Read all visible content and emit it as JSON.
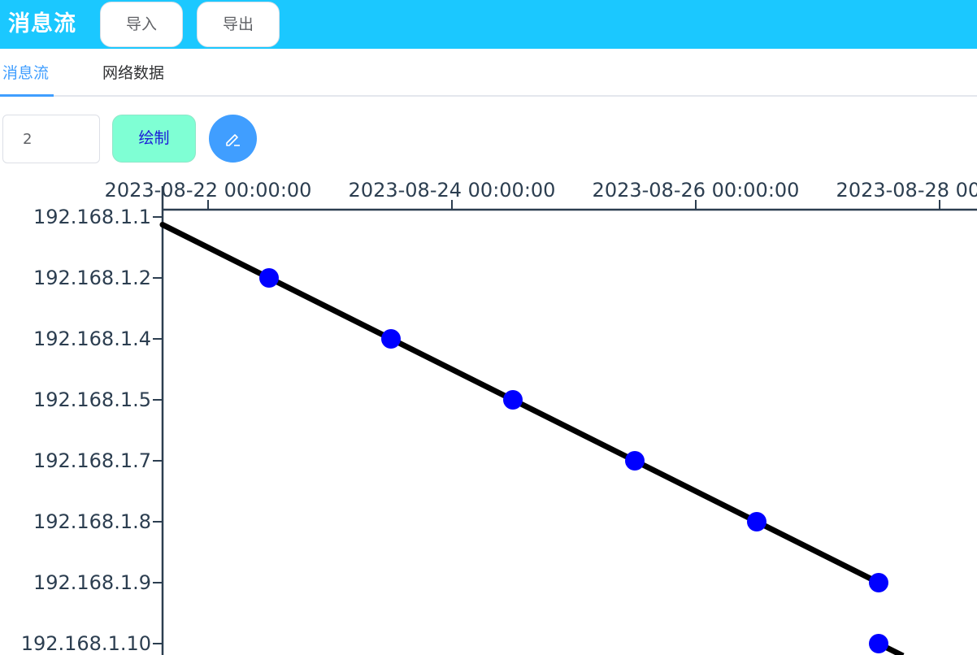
{
  "header": {
    "title": "消息流",
    "import_label": "导入",
    "export_label": "导出"
  },
  "tabs": [
    {
      "label": "消息流",
      "active": true
    },
    {
      "label": "网络数据",
      "active": false
    }
  ],
  "controls": {
    "count_value": "2",
    "draw_label": "绘制",
    "edit_icon": "pencil-icon"
  },
  "colors": {
    "header_bg": "#1bc8ff",
    "accent": "#409eff",
    "draw_button_bg": "#7fffd4",
    "point": "#0000ff",
    "line": "#000000"
  },
  "chart_data": {
    "type": "line",
    "x_ticks": [
      "2023-08-22 00:00:00",
      "2023-08-24 00:00:00",
      "2023-08-26 00:00:00",
      "2023-08-28 00:00:00"
    ],
    "y_categories": [
      "192.168.1.1",
      "192.168.1.2",
      "192.168.1.4",
      "192.168.1.5",
      "192.168.1.7",
      "192.168.1.8",
      "192.168.1.9",
      "192.168.1.10"
    ],
    "points": [
      {
        "x": "2023-08-22 12:00",
        "y": "192.168.1.2"
      },
      {
        "x": "2023-08-23 12:00",
        "y": "192.168.1.4"
      },
      {
        "x": "2023-08-24 12:00",
        "y": "192.168.1.5"
      },
      {
        "x": "2023-08-25 12:00",
        "y": "192.168.1.7"
      },
      {
        "x": "2023-08-26 12:00",
        "y": "192.168.1.8"
      },
      {
        "x": "2023-08-27 12:00",
        "y": "192.168.1.9"
      },
      {
        "x": "2023-08-27 12:00",
        "y": "192.168.1.10"
      }
    ]
  }
}
